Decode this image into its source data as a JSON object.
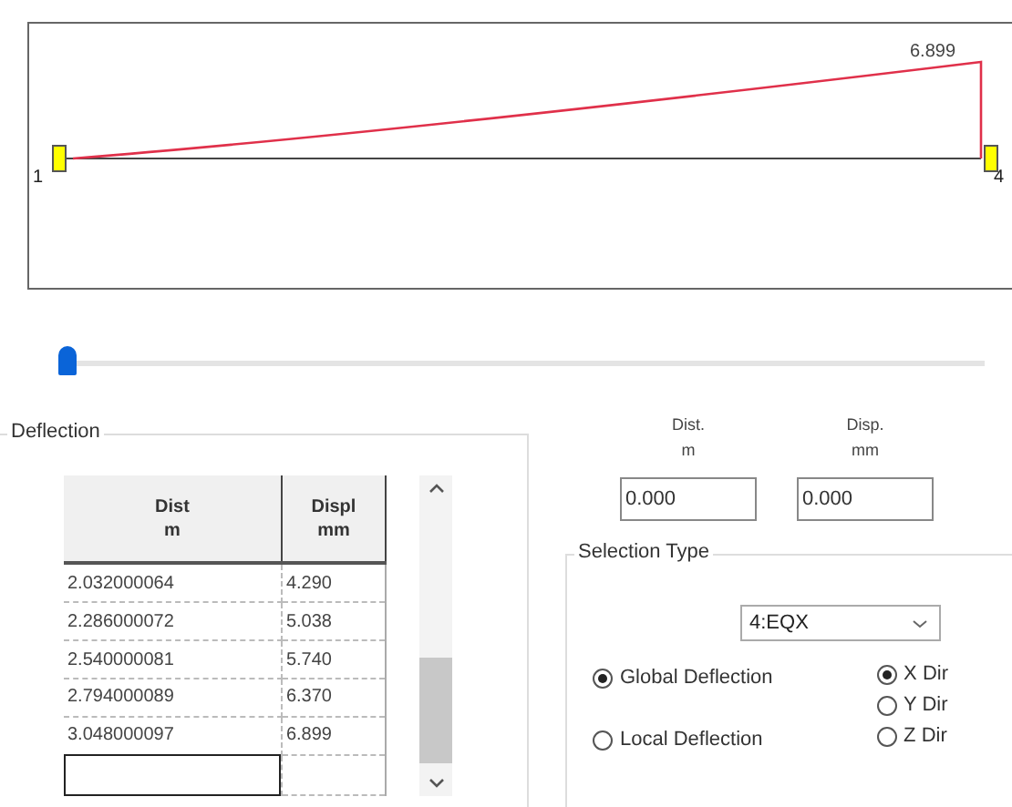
{
  "diagram": {
    "peak_label": "6.899",
    "start_node": "1",
    "end_node": "4"
  },
  "slider": {
    "level": 0.0
  },
  "deflection": {
    "title": "Deflection",
    "columns": [
      {
        "line1": "Dist",
        "line2": "m"
      },
      {
        "line1": "Displ",
        "line2": "mm"
      }
    ],
    "rows": [
      [
        "2.032000064",
        "4.290"
      ],
      [
        "2.286000072",
        "5.038"
      ],
      [
        "2.540000081",
        "5.740"
      ],
      [
        "2.794000089",
        "6.370"
      ],
      [
        "3.048000097",
        "6.899"
      ]
    ]
  },
  "inputs": [
    {
      "label1": "Dist.",
      "label2": "m",
      "value": "0.000"
    },
    {
      "label1": "Disp.",
      "label2": "mm",
      "value": "0.000"
    }
  ],
  "selection_type": {
    "title": "Selection Type",
    "dropdown": "4:EQX",
    "deflection_modes": [
      {
        "label": "Global Deflection",
        "selected": true
      },
      {
        "label": "Local Deflection",
        "selected": false
      }
    ],
    "directions": [
      {
        "label": "X Dir",
        "selected": true
      },
      {
        "label": "Y Dir",
        "selected": false
      },
      {
        "label": "Z Dir",
        "selected": false
      }
    ]
  }
}
